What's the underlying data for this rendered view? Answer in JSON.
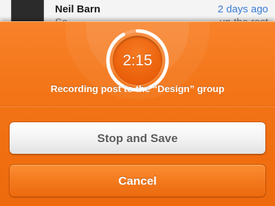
{
  "feed": {
    "name": "Neil Barn",
    "time": "2 days ago",
    "snippet_left": "So",
    "snippet_right": "up the rest"
  },
  "recorder": {
    "timer": "2:15",
    "progress_fraction": 0.92,
    "caption": "Recording post to the “Design” group",
    "colors": {
      "panel": "#f27416",
      "ring": "#ffffff",
      "stop_button": "#f2f2f2",
      "cancel_button": "#f47a1e"
    }
  },
  "buttons": {
    "stop_label": "Stop and Save",
    "cancel_label": "Cancel"
  }
}
